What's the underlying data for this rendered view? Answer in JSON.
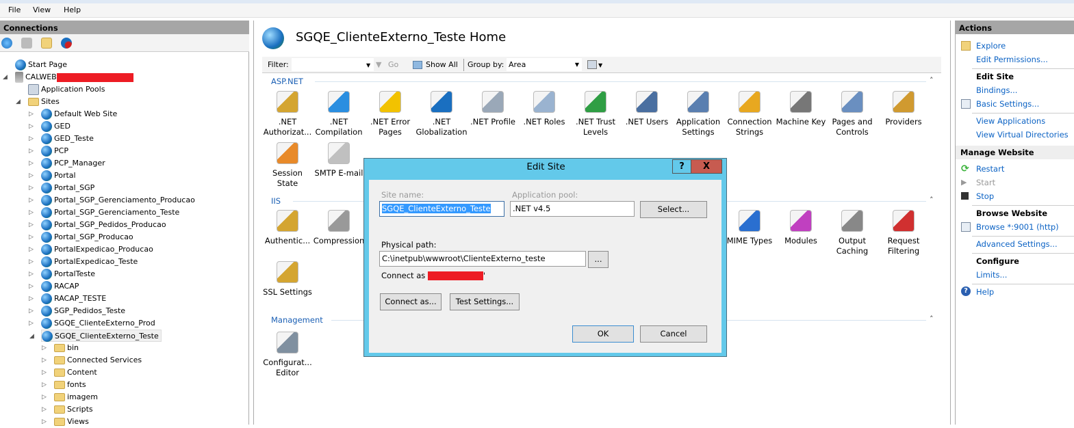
{
  "menu": [
    "File",
    "View",
    "Help"
  ],
  "connections": {
    "title": "Connections",
    "tree": {
      "start_page": "Start Page",
      "server": "CALWEB",
      "app_pools": "Application Pools",
      "sites_label": "Sites",
      "sites": [
        "Default Web Site",
        "GED",
        "GED_Teste",
        "PCP",
        "PCP_Manager",
        "Portal",
        "Portal_SGP",
        "Portal_SGP_Gerenciamento_Producao",
        "Portal_SGP_Gerenciamento_Teste",
        "Portal_SGP_Pedidos_Producao",
        "Portal_SGP_Producao",
        "PortalExpedicao_Producao",
        "PortalExpedicao_Teste",
        "PortalTeste",
        "RACAP",
        "RACAP_TESTE",
        "SGP_Pedidos_Teste",
        "SGQE_ClienteExterno_Prod",
        "SGQE_ClienteExterno_Teste"
      ],
      "selected_site": "SGQE_ClienteExterno_Teste",
      "children": [
        "bin",
        "Connected Services",
        "Content",
        "fonts",
        "imagem",
        "Scripts",
        "Views"
      ]
    }
  },
  "main": {
    "title": "SGQE_ClienteExterno_Teste Home",
    "filter": {
      "label": "Filter:",
      "value": "",
      "go": "Go",
      "show_all": "Show All",
      "group_by_label": "Group by:",
      "group_by_value": "Area"
    },
    "sections": [
      {
        "name": "ASP.NET",
        "features": [
          {
            "label": ".NET Authorizat...",
            "icon": "lock-document",
            "color": "#d4a531"
          },
          {
            "label": ".NET Compilation",
            "icon": "download-stack",
            "color": "#2a8ee0"
          },
          {
            "label": ".NET Error Pages",
            "icon": "warning-404",
            "color": "#f2c200"
          },
          {
            "label": ".NET Globalization",
            "icon": "globe",
            "color": "#1a6fc0"
          },
          {
            "label": ".NET Profile",
            "icon": "profile-card",
            "color": "#9aa8b8"
          },
          {
            "label": ".NET Roles",
            "icon": "tags",
            "color": "#9ab3d0"
          },
          {
            "label": ".NET Trust Levels",
            "icon": "globe-check",
            "color": "#2f9e44"
          },
          {
            "label": ".NET Users",
            "icon": "user",
            "color": "#4a6fa0"
          },
          {
            "label": "Application Settings",
            "icon": "checklist",
            "color": "#5a7fb0"
          },
          {
            "label": "Connection Strings",
            "icon": "database",
            "color": "#e8a820"
          },
          {
            "label": "Machine Key",
            "icon": "server-key",
            "color": "#777777"
          },
          {
            "label": "Pages and Controls",
            "icon": "page-grid",
            "color": "#6a8fc0"
          },
          {
            "label": "Providers",
            "icon": "users-db",
            "color": "#d09a30"
          },
          {
            "label": "Session State",
            "icon": "user-diamond",
            "color": "#e88a2a"
          },
          {
            "label": "SMTP E-mail",
            "icon": "envelope",
            "color": "#c0c0c0"
          }
        ]
      },
      {
        "name": "IIS",
        "features": [
          {
            "label": "Authentic...",
            "icon": "user-lock",
            "color": "#d4a531"
          },
          {
            "label": "Compression",
            "icon": "clamp",
            "color": "#999999"
          },
          {
            "label": "MIME Types",
            "icon": "music-image",
            "color": "#2a6fd0"
          },
          {
            "label": "Modules",
            "icon": "arrows-modules",
            "color": "#c040c0"
          },
          {
            "label": "Output Caching",
            "icon": "server-globe",
            "color": "#888888"
          },
          {
            "label": "Request Filtering",
            "icon": "document-filter",
            "color": "#d03030"
          },
          {
            "label": "SSL Settings",
            "icon": "padlock",
            "color": "#d4a531"
          }
        ]
      },
      {
        "name": "Management",
        "features": [
          {
            "label": "Configurat... Editor",
            "icon": "config-document",
            "color": "#8090a0"
          }
        ]
      }
    ]
  },
  "actions": {
    "title": "Actions",
    "explore": "Explore",
    "edit_permissions": "Edit Permissions...",
    "edit_site": "Edit Site",
    "bindings": "Bindings...",
    "basic_settings": "Basic Settings...",
    "view_applications": "View Applications",
    "view_virtual_directories": "View Virtual Directories",
    "manage_website": "Manage Website",
    "restart": "Restart",
    "start": "Start",
    "stop": "Stop",
    "browse_website": "Browse Website",
    "browse": "Browse *:9001 (http)",
    "advanced_settings": "Advanced Settings...",
    "configure": "Configure",
    "limits": "Limits...",
    "help": "Help"
  },
  "dialog": {
    "title": "Edit Site",
    "help": "?",
    "close": "X",
    "site_name_label": "Site name:",
    "site_name": "SGQE_ClienteExterno_Teste",
    "app_pool_label": "Application pool:",
    "app_pool": ".NET v4.5",
    "select": "Select...",
    "physical_path_label": "Physical path:",
    "physical_path": "C:\\inetpub\\wwwroot\\ClienteExterno_teste",
    "browse": "...",
    "connect_as_text": "Connect as",
    "connect_as_suffix": "'",
    "connect_as_button": "Connect as...",
    "test_settings": "Test Settings...",
    "ok": "OK",
    "cancel": "Cancel"
  }
}
